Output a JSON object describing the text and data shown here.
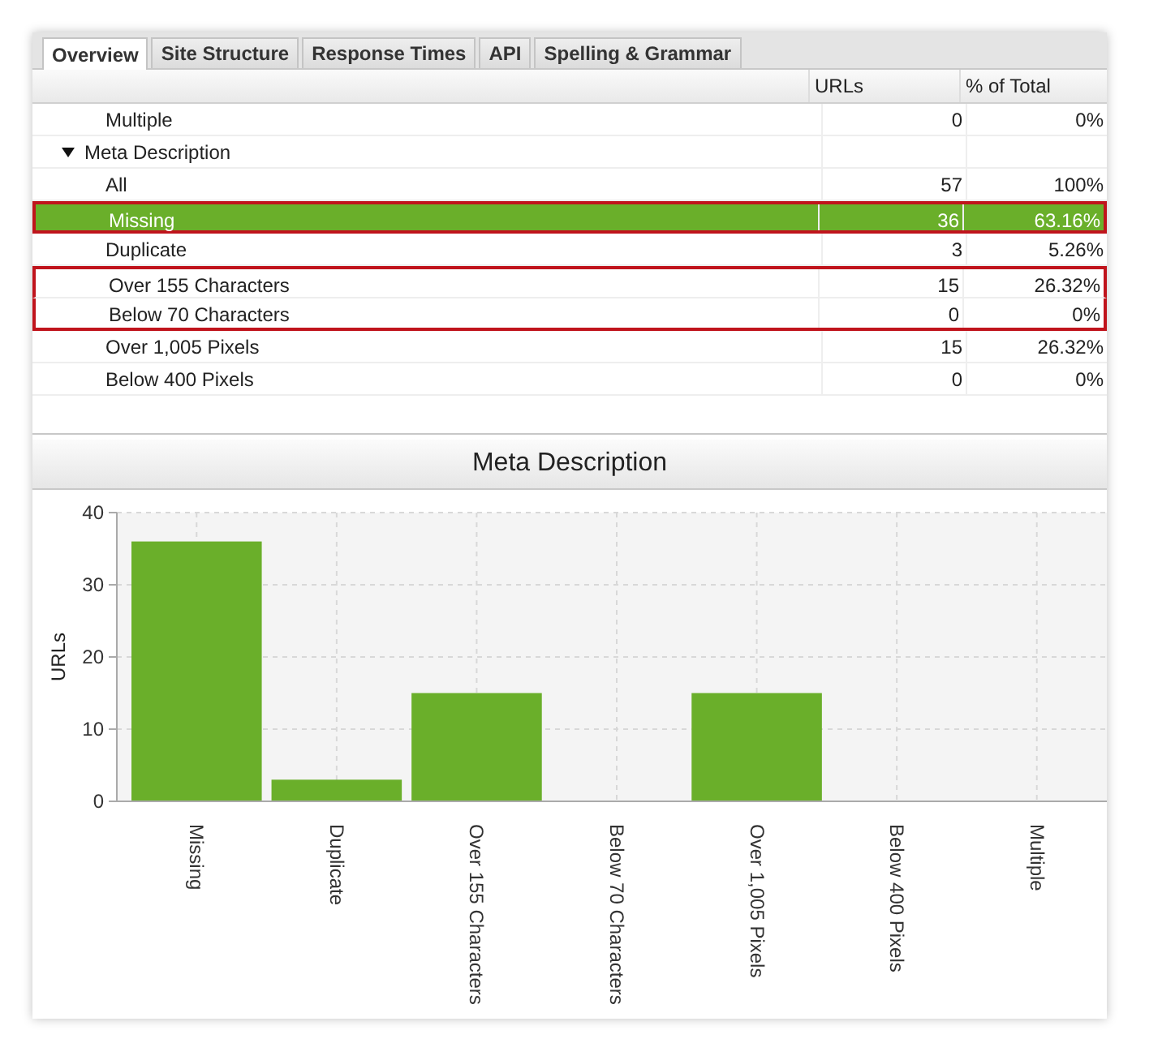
{
  "tabs": [
    {
      "label": "Overview",
      "selected": true
    },
    {
      "label": "Site Structure",
      "selected": false
    },
    {
      "label": "Response Times",
      "selected": false
    },
    {
      "label": "API",
      "selected": false
    },
    {
      "label": "Spelling & Grammar",
      "selected": false
    }
  ],
  "table": {
    "columns": [
      "URLs",
      "% of Total"
    ],
    "rows": [
      {
        "kind": "leaf",
        "label": "Multiple",
        "urls": "0",
        "percent": "0%",
        "selected": false,
        "outlined": false
      },
      {
        "kind": "group",
        "label": "Meta Description",
        "expanded": true,
        "children": [
          {
            "kind": "leaf",
            "label": "All",
            "urls": "57",
            "percent": "100%",
            "selected": false,
            "outlined": false
          },
          {
            "kind": "leaf",
            "label": "Missing",
            "urls": "36",
            "percent": "63.16%",
            "selected": true,
            "outlined": true
          },
          {
            "kind": "leaf",
            "label": "Duplicate",
            "urls": "3",
            "percent": "5.26%",
            "selected": false,
            "outlined": false
          },
          {
            "kind": "leaf",
            "label": "Over 155 Characters",
            "urls": "15",
            "percent": "26.32%",
            "selected": false,
            "outlined": true
          },
          {
            "kind": "leaf",
            "label": "Below 70 Characters",
            "urls": "0",
            "percent": "0%",
            "selected": false,
            "outlined": true
          },
          {
            "kind": "leaf",
            "label": "Over 1,005 Pixels",
            "urls": "15",
            "percent": "26.32%",
            "selected": false,
            "outlined": false
          },
          {
            "kind": "leaf",
            "label": "Below 400 Pixels",
            "urls": "0",
            "percent": "0%",
            "selected": false,
            "outlined": false
          }
        ]
      }
    ]
  },
  "chart": {
    "title": "Meta Description",
    "chart_data": {
      "type": "bar",
      "ylabel": "URLs",
      "categories": [
        "Missing",
        "Duplicate",
        "Over 155 Characters",
        "Below 70 Characters",
        "Over 1,005 Pixels",
        "Below 400 Pixels",
        "Multiple"
      ],
      "series": [
        {
          "color": "#6aaf2a",
          "values": [
            36,
            3,
            15,
            0,
            15,
            0,
            0
          ]
        }
      ],
      "grid": true,
      "ylim": [
        0,
        40
      ],
      "yticks": [
        0,
        10,
        20,
        30,
        40
      ]
    }
  }
}
